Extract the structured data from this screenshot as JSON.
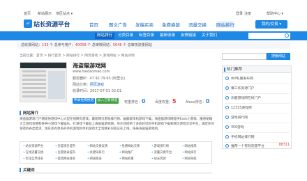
{
  "topbar": {
    "home": "首页",
    "new_games": "新站展示",
    "region": "地区站点 ▾",
    "login": "登录",
    "register": "注册",
    "help": "帮助中心 ▾"
  },
  "logo": {
    "badge": "wf",
    "text": "站长资源平台"
  },
  "nav": [
    "首页",
    "图文广告",
    "发稿买卖",
    "免费换链",
    "流量交换",
    "网站排行"
  ],
  "nav_active": 5,
  "login_button": "我的/交易 ▾",
  "subnav": [
    "网站排行",
    "分类目录",
    "标签目录",
    "最新收录",
    "友情链接",
    "关于我们"
  ],
  "subnav_active": 0,
  "stats": {
    "pre": "总收录网站：",
    "sites": "133",
    "mid1": " 个 总参与用户：",
    "users": "40058",
    "mid2": " 个 总审核网站：",
    "reviewed": "5048",
    "post": " 个 总审核流量网站"
  },
  "breadcrumb": "当前位置：首页 > 排行首页 > 网站排行 > 网页游戏 > 游戏网站 > 网站详情",
  "site": {
    "title": "海盗猫游戏网",
    "url": "www.haidaomao.com",
    "ip_label": "服务器IP：",
    "ip": "47.92.79.65 (阿里云)",
    "cat_label": "网站分类：",
    "category": "网页游戏",
    "date_label": "收录时间：",
    "date": "2017-07-01 02:01",
    "btn_visit": "申请免费换链",
    "btn_report": "加入已有频道"
  },
  "scores": {
    "pr_label": "权重排名：",
    "pr": "0",
    "baidu_label": "百度权重：",
    "baidu": "5",
    "alexa_label": "Alexa排名：",
    "alexa": "0"
  },
  "intro_heading": "网站简介",
  "intro_text": "海盗猫游戏门户网提供游戏中心大型在线网页游戏，最新网页游戏排行榜、破解版单机游戏下载。海盗猫游戏网提供flash小游戏、魔兽秘籍大全游戏攻略和各种小游戏下载娱乐，打游戏下载就上海盗猫游戏网。另外还提供了多款好玩的手机游戏下载和网页游戏交流平台，满足你对游戏的各类需求，现在还有更多的手机游戏和单机游戏大全等精彩内容正在上线，快来海盗猫游戏吧。",
  "tags": [
    "站长资源平台",
    "百度排名提升",
    "网站交换友情",
    "免费网站交换",
    "游戏排行榜",
    "网站推荐",
    "在线流量交换",
    "百度收录提升",
    "关键词排行",
    "网站推广",
    "流量交换平台",
    "网站排行",
    "优化自然排名",
    "提高网站排名",
    "网站收录",
    "网站权重",
    "站长资源",
    "网站导航"
  ],
  "keywords_heading": "关键词",
  "side": {
    "search_btn": "搜索网站",
    "hot_heading": "热门推荐",
    "hot": [
      {
        "name": "dnf私服发布网",
        "count": ""
      },
      {
        "name": "赚工作资源门户",
        "count": ""
      },
      {
        "name": "乐酷游戏网在线门户",
        "count": ""
      },
      {
        "name": "12315游戏网",
        "count": ""
      },
      {
        "name": "游戏排行网",
        "count": ""
      },
      {
        "name": "350游戏",
        "count": ""
      },
      {
        "name": "手机网站排行网",
        "count": ""
      },
      {
        "name": "推荐一个有效流量平台",
        "count": "88311"
      }
    ]
  }
}
